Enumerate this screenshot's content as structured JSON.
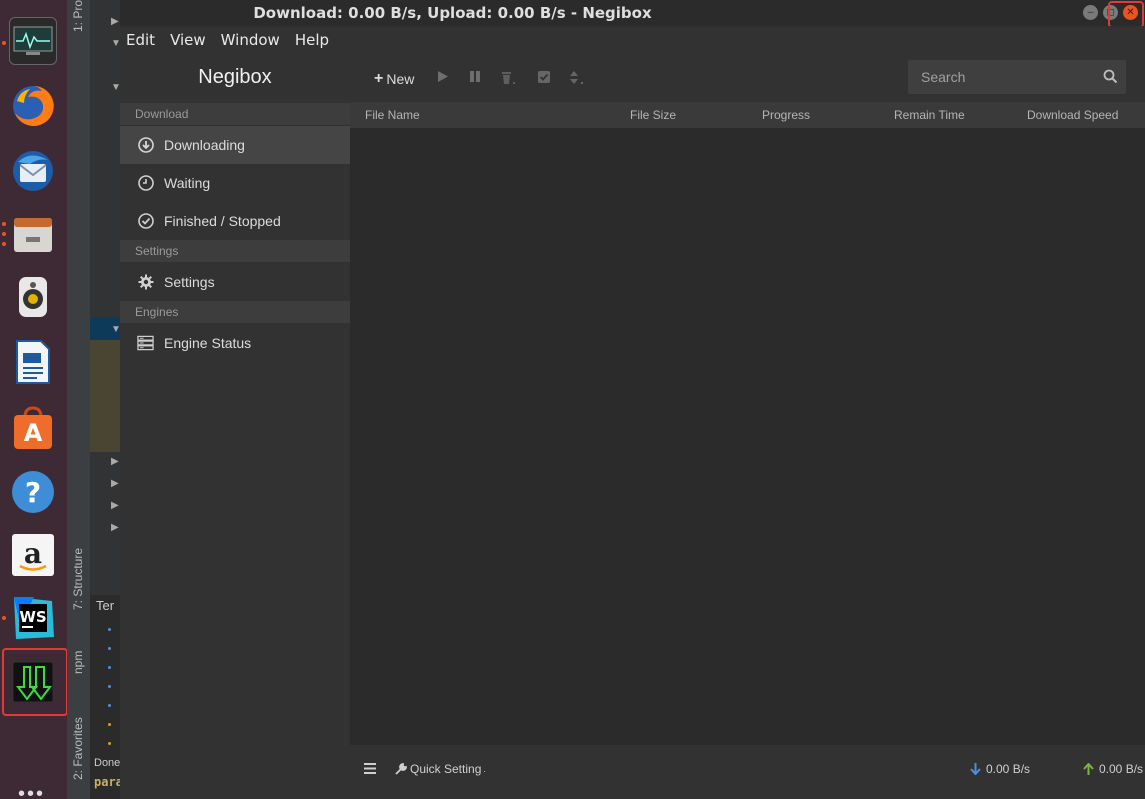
{
  "window": {
    "title": "Download: 0.00 B/s, Upload: 0.00 B/s - Negibox",
    "controls": [
      "minimize",
      "maximize",
      "close"
    ]
  },
  "menubar": [
    "Edit",
    "View",
    "Window",
    "Help"
  ],
  "sidebar": {
    "brand": "Negibox",
    "sections": [
      {
        "label": "Download",
        "items": [
          {
            "label": "Downloading",
            "icon": "download-circle-icon",
            "active": true
          },
          {
            "label": "Waiting",
            "icon": "clock-icon",
            "active": false
          },
          {
            "label": "Finished / Stopped",
            "icon": "check-circle-icon",
            "active": false
          }
        ]
      },
      {
        "label": "Settings",
        "items": [
          {
            "label": "Settings",
            "icon": "gear-icon",
            "active": false
          }
        ]
      },
      {
        "label": "Engines",
        "items": [
          {
            "label": "Engine Status",
            "icon": "server-icon",
            "active": false
          }
        ]
      }
    ]
  },
  "toolbar": {
    "new_label": "New",
    "search_placeholder": "Search",
    "buttons": [
      "plus-icon",
      "play-icon",
      "pause-icon",
      "trash-icon",
      "select-all-icon",
      "sort-icon"
    ]
  },
  "table": {
    "columns": [
      "File Name",
      "File Size",
      "Progress",
      "Remain Time",
      "Download Speed"
    ],
    "rows": []
  },
  "statusbar": {
    "quick_setting": "Quick Setting",
    "download_speed": "0.00 B/s",
    "upload_speed": "0.00 B/s"
  },
  "ide": {
    "tabs": [
      "1: Pro",
      "7: Structure",
      "npm",
      "2: Favorites"
    ],
    "terminal_title": "Ter",
    "done_text": "Done",
    "para_text": "para"
  },
  "launcher": [
    "system-monitor-icon",
    "firefox-icon",
    "thunderbird-icon",
    "files-icon",
    "rhythmbox-icon",
    "writer-icon",
    "software-center-icon",
    "help-icon",
    "amazon-icon",
    "webstorm-icon",
    "negibox-icon",
    "apps-grid-icon"
  ],
  "colors": {
    "accent_close": "#e9541f",
    "highlight": "#e53935",
    "download_arrow": "#4a90e2",
    "upload_arrow": "#7cb342"
  }
}
